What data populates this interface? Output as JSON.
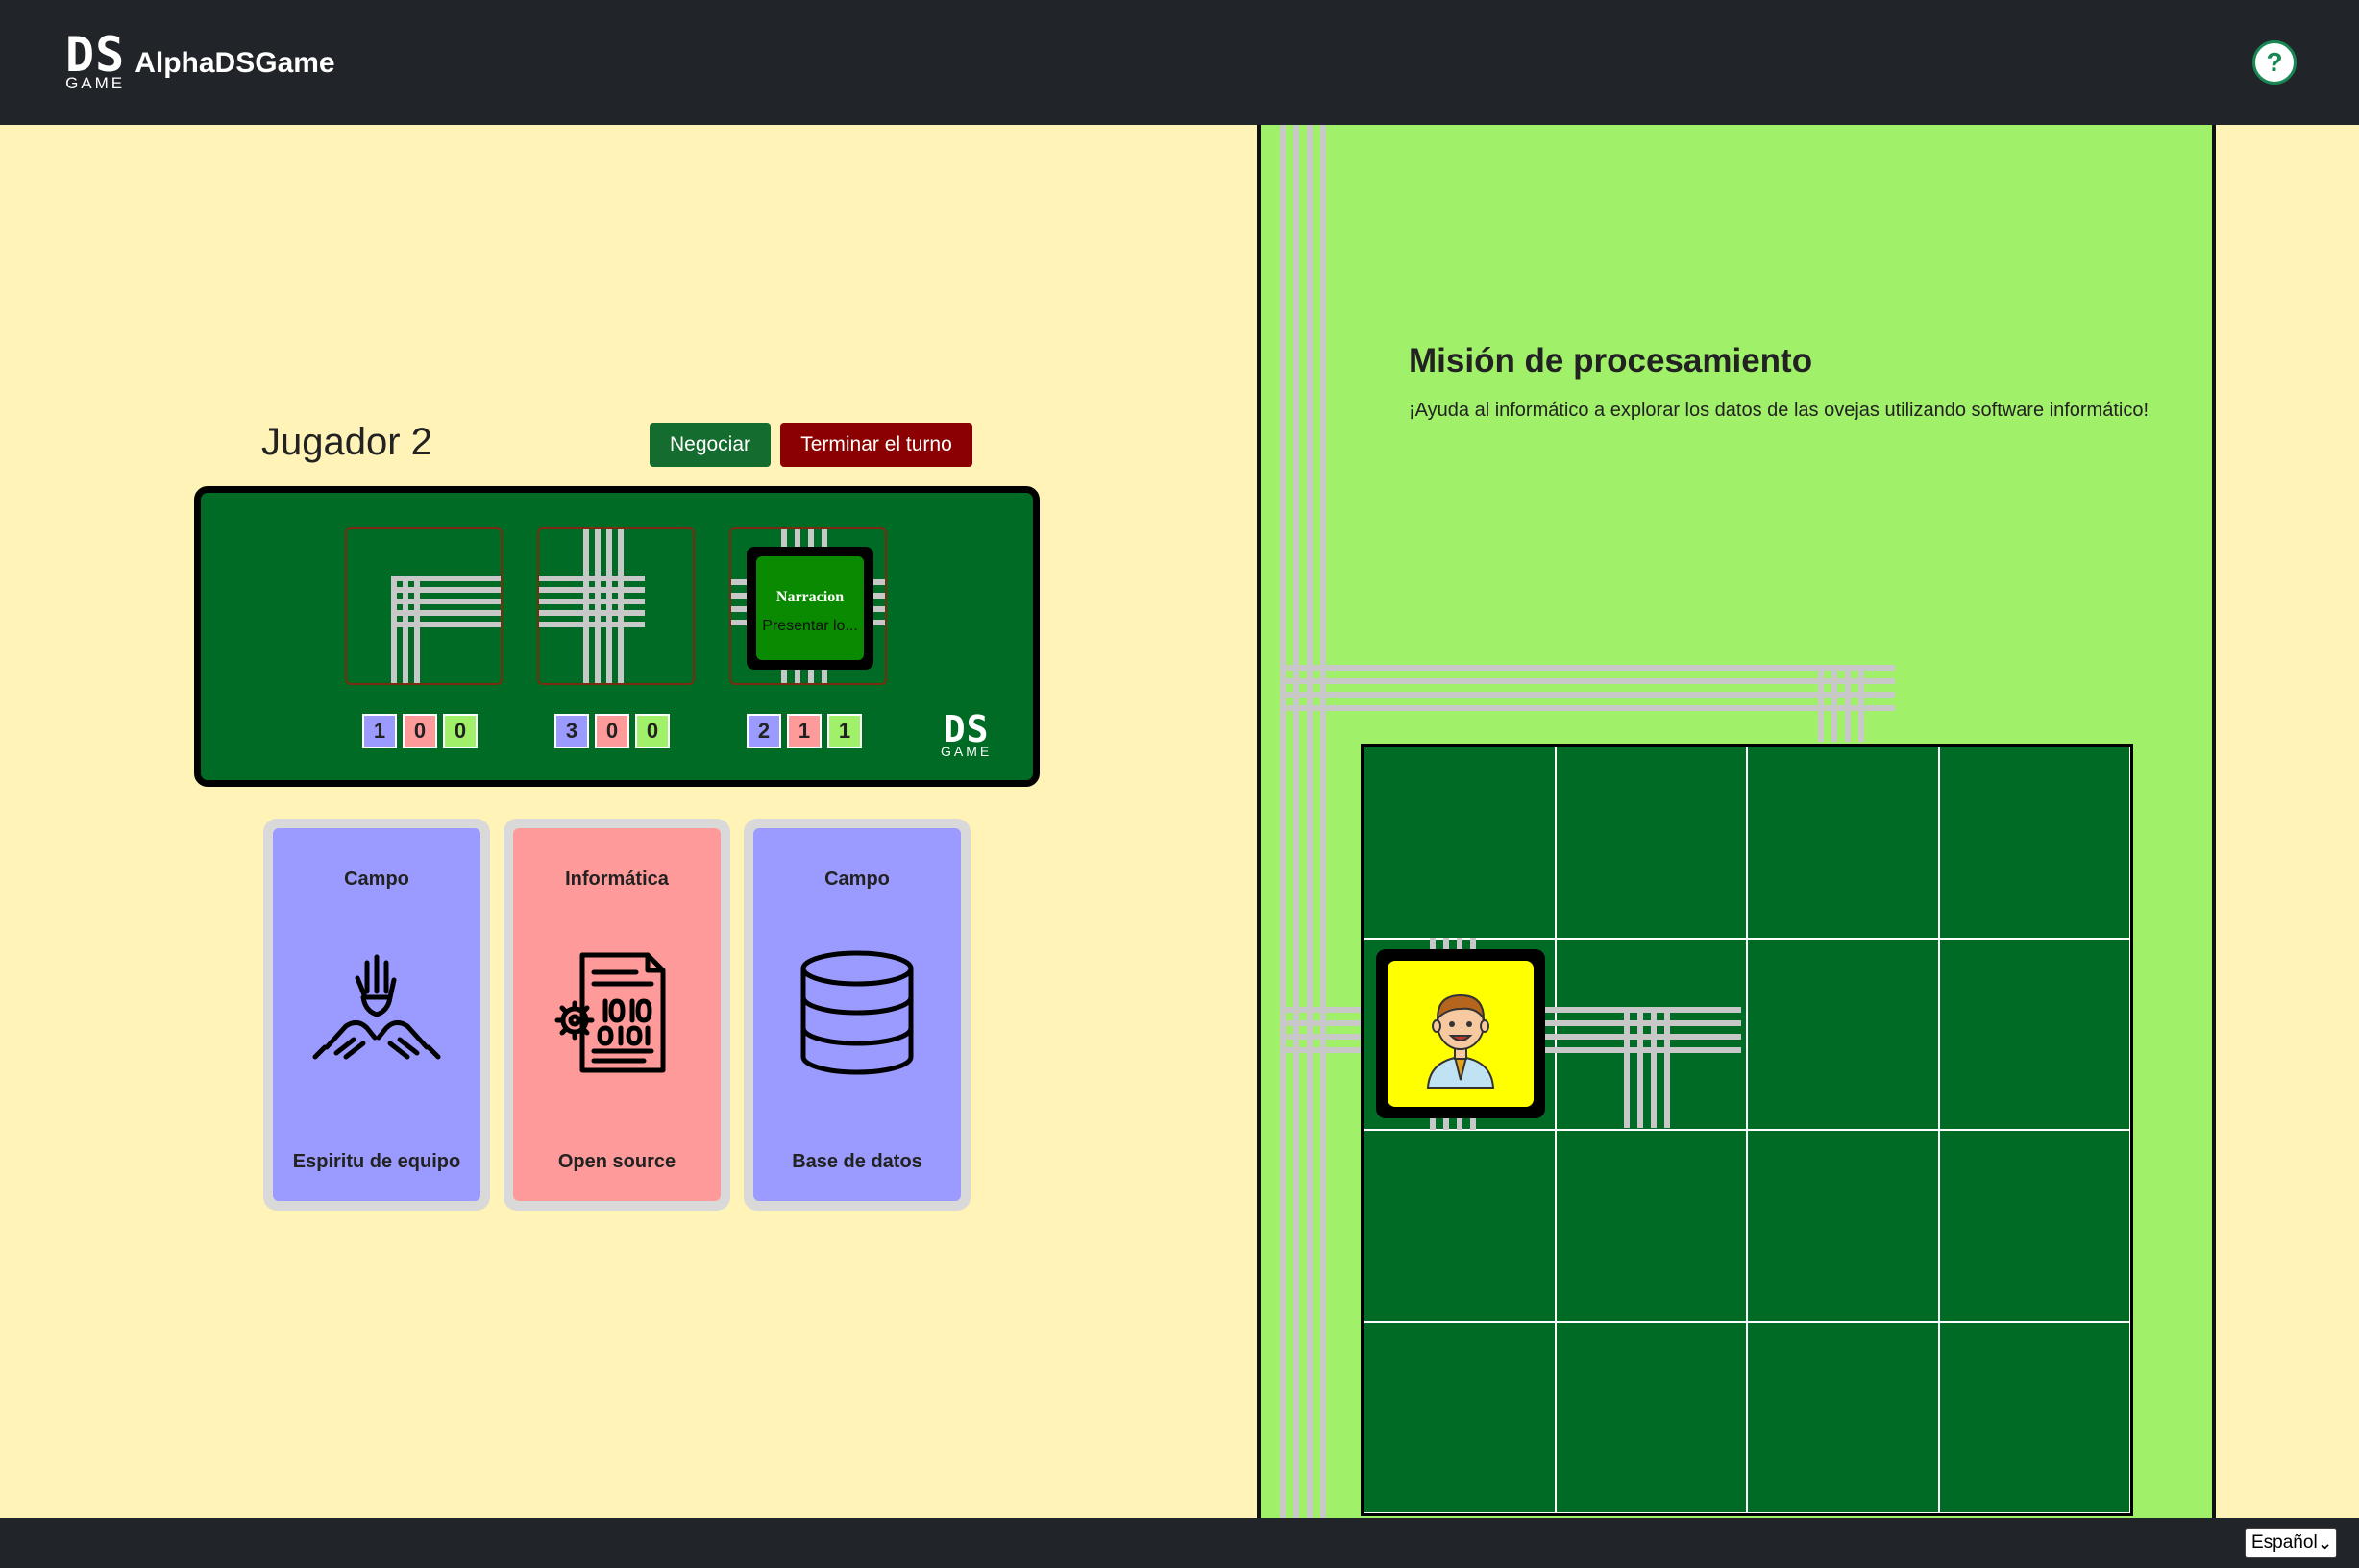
{
  "header": {
    "logo_ds": "DS",
    "logo_game": "GAME",
    "app_name": "AlphaDSGame",
    "help_symbol": "?"
  },
  "player": {
    "name": "Jugador 2",
    "negotiate_label": "Negociar",
    "end_turn_label": "Terminar el turno"
  },
  "board": {
    "slots": [
      {
        "counts": [
          "1",
          "0",
          "0"
        ]
      },
      {
        "counts": [
          "3",
          "0",
          "0"
        ]
      },
      {
        "counts": [
          "2",
          "1",
          "1"
        ],
        "card_title": "Narracion",
        "card_desc": "Presentar lo..."
      }
    ],
    "logo_ds": "DS",
    "logo_game": "GAME"
  },
  "hand": [
    {
      "type": "Campo",
      "name": "Espiritu de equipo",
      "icon": "teamwork-hands-icon",
      "color": "#9b9bff"
    },
    {
      "type": "Informática",
      "name": "Open source",
      "icon": "source-code-gear-icon",
      "color": "#ff9a9a"
    },
    {
      "type": "Campo",
      "name": "Base de datos",
      "icon": "database-icon",
      "color": "#9b9bff"
    }
  ],
  "mission": {
    "title": "Misión de procesamiento",
    "description": "¡Ayuda al informático a explorar los datos de las ovejas utilizando software informático!",
    "piece_icon": "computer-scientist-avatar-icon"
  },
  "footer": {
    "language": "Español"
  },
  "colors": {
    "navbar": "#212529",
    "board_green": "#006b24",
    "mission_bg": "#a0f06a",
    "page_bg": "#fff3b8"
  }
}
